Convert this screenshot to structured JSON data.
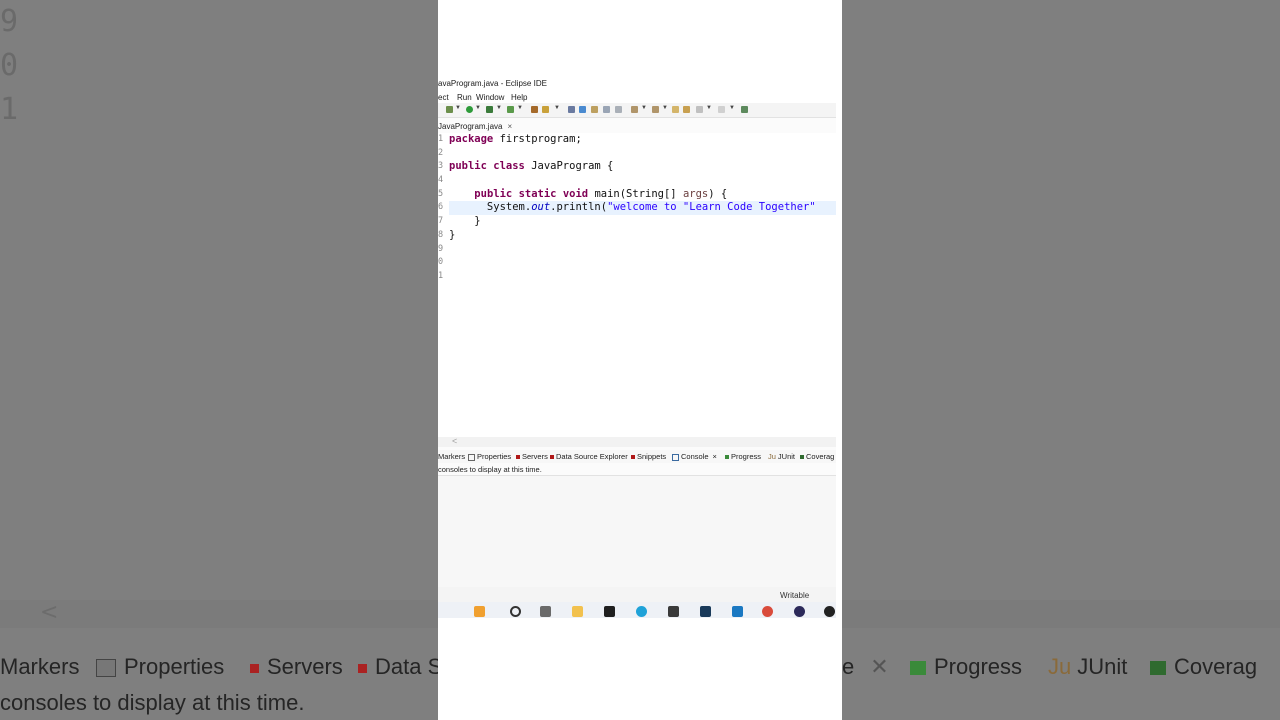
{
  "background": {
    "gutter_numbers": [
      "9",
      "0",
      "1"
    ],
    "scroll_arrow": "<",
    "view_tabs": [
      "Markers",
      "Properties",
      "Servers",
      "Data S",
      "e",
      "Progress",
      "JUnit",
      "Coverag"
    ],
    "console_message": "consoles to display at this time."
  },
  "window": {
    "title": "avaProgram.java - Eclipse IDE"
  },
  "menu": {
    "items": [
      "ect",
      "Run",
      "Window",
      "Help"
    ]
  },
  "editor": {
    "tab_label": "JavaProgram.java",
    "tab_close": "×",
    "gutter": [
      "1",
      "2",
      "3",
      "4",
      "5",
      "6",
      "7",
      "8",
      "9",
      "0",
      "1"
    ],
    "lines": {
      "l1_kw": "package",
      "l1_rest": " firstprogram;",
      "l3_kw1": "public",
      "l3_kw2": "class",
      "l3_rest": " JavaProgram {",
      "l5_indent": "    ",
      "l5_kw1": "public",
      "l5_kw2": "static",
      "l5_kw3": "void",
      "l5_rest": " main(String[] ",
      "l5_arg": "args",
      "l5_end": ") {",
      "l6_pre": "      System.",
      "l6_field": "out",
      "l6_mid": ".println(",
      "l6_str": "\"welcome to \"Learn Code Together\"",
      "l7": "    }",
      "l8": "}"
    }
  },
  "scroll": {
    "arrow": "<"
  },
  "view_tabs": {
    "markers": "Markers",
    "properties": "Properties",
    "servers": "Servers",
    "data_source_explorer": "Data Source Explorer",
    "snippets": "Snippets",
    "console": "Console",
    "console_close": "×",
    "progress": "Progress",
    "junit": "JUnit",
    "coverage": "Coverag"
  },
  "console": {
    "message": "consoles to display at this time."
  },
  "status": {
    "writable": "Writable"
  },
  "colors": {
    "keyword": "#7f0055",
    "string": "#2a00ff",
    "field": "#0000c0",
    "current_line": "#e8f2fe"
  }
}
